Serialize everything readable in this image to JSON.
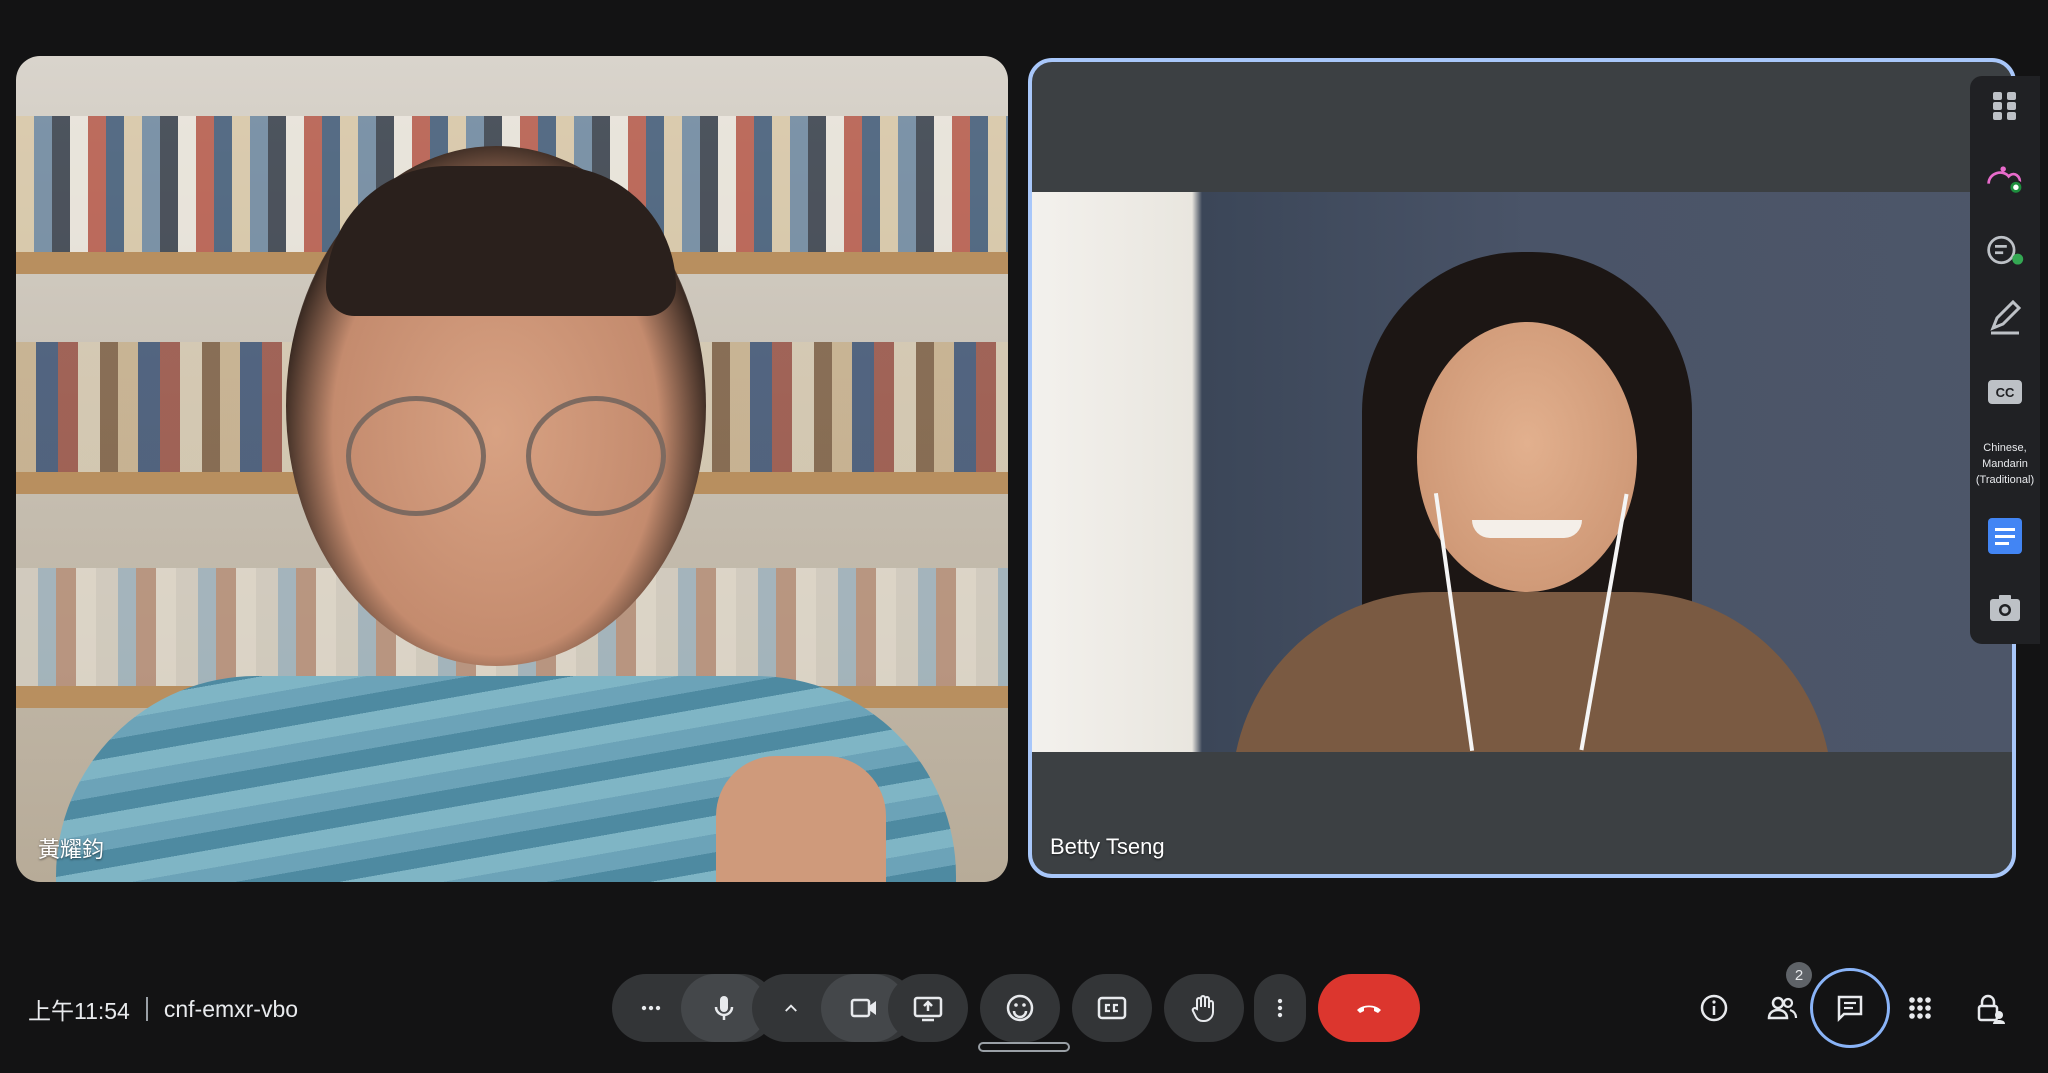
{
  "participants": [
    {
      "name": "黃耀鈞"
    },
    {
      "name": "Betty Tseng"
    }
  ],
  "side_panel": {
    "caption_language": "Chinese, Mandarin (Traditional)",
    "icons": [
      "apps-grid-icon",
      "activities-icon",
      "ai-notes-icon",
      "whiteboard-pen-icon",
      "captions-cc-icon",
      "docs-icon",
      "camera-snapshot-icon"
    ],
    "caption_badge": "CC"
  },
  "meeting": {
    "time": "上午11:54",
    "code": "cnf-emxr-vbo"
  },
  "controls": [
    "more-options",
    "microphone",
    "camera-options",
    "camera",
    "present-screen",
    "reactions",
    "captions",
    "raise-hand",
    "more-vert",
    "leave-call"
  ],
  "right_controls": {
    "people_count": "2"
  },
  "colors": {
    "background": "#131314",
    "control_bg": "#333537",
    "leave_red": "#dc362e",
    "active_border": "#a8c7fa"
  }
}
